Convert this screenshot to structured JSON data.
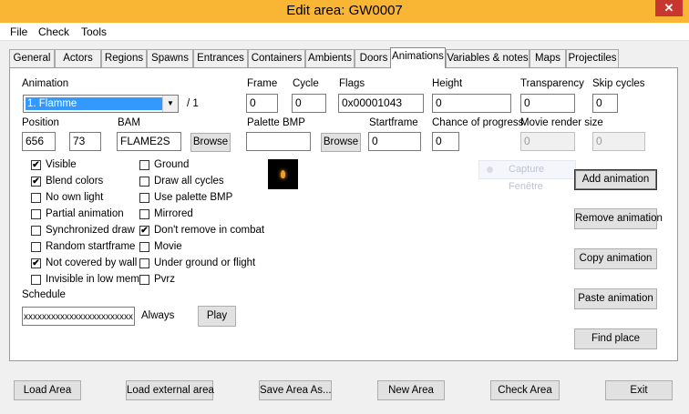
{
  "window": {
    "title": "Edit area: GW0007",
    "close_glyph": "✕"
  },
  "menu": [
    "File",
    "Check",
    "Tools"
  ],
  "tabs": [
    "General",
    "Actors",
    "Regions",
    "Spawns",
    "Entrances",
    "Containers",
    "Ambients",
    "Doors",
    "Animations",
    "Variables & notes",
    "Maps",
    "Projectiles"
  ],
  "active_tab": "Animations",
  "animation": {
    "label": "Animation",
    "selected": "1. Flamme",
    "count": "/ 1",
    "frame_label": "Frame",
    "frame": "0",
    "cycle_label": "Cycle",
    "cycle": "0",
    "flags_label": "Flags",
    "flags": "0x00001043",
    "height_label": "Height",
    "height": "0",
    "transparency_label": "Transparency",
    "transparency": "0",
    "skip_label": "Skip cycles",
    "skip": "0",
    "position_label": "Position",
    "pos_x": "656",
    "pos_y": "73",
    "bam_label": "BAM",
    "bam": "FLAME2S",
    "bam_browse": "Browse",
    "palette_label": "Palette BMP",
    "palette": "",
    "palette_browse": "Browse",
    "startframe_label": "Startframe",
    "startframe": "0",
    "chance_label": "Chance of progress",
    "chance": "0",
    "movie_label": "Movie render size",
    "movie_w": "0",
    "movie_h": "0"
  },
  "checkboxes_left": [
    {
      "label": "Visible",
      "checked": true
    },
    {
      "label": "Blend colors",
      "checked": true
    },
    {
      "label": "No own light",
      "checked": false
    },
    {
      "label": "Partial animation",
      "checked": false
    },
    {
      "label": "Synchronized draw",
      "checked": false
    },
    {
      "label": "Random startframe",
      "checked": false
    },
    {
      "label": "Not covered by wall",
      "checked": true
    },
    {
      "label": "Invisible in low mem.",
      "checked": false
    }
  ],
  "checkboxes_right": [
    {
      "label": "Ground",
      "checked": false
    },
    {
      "label": "Draw all cycles",
      "checked": false
    },
    {
      "label": "Use palette BMP",
      "checked": false
    },
    {
      "label": "Mirrored",
      "checked": false
    },
    {
      "label": "Don't remove in combat",
      "checked": true
    },
    {
      "label": "Movie",
      "checked": false
    },
    {
      "label": "Under ground or flight",
      "checked": false
    },
    {
      "label": "Pvrz",
      "checked": false
    }
  ],
  "schedule": {
    "label": "Schedule",
    "value": "xxxxxxxxxxxxxxxxxxxxxxxx",
    "text": "Always",
    "play": "Play"
  },
  "capture_ghost": "Capture Fenêtre",
  "side_buttons": [
    "Add animation",
    "Remove animation",
    "Copy animation",
    "Paste animation",
    "Find place"
  ],
  "bottom_buttons": [
    "Load Area",
    "Load external area",
    "Save Area As...",
    "New Area",
    "Check Area",
    "Exit"
  ]
}
